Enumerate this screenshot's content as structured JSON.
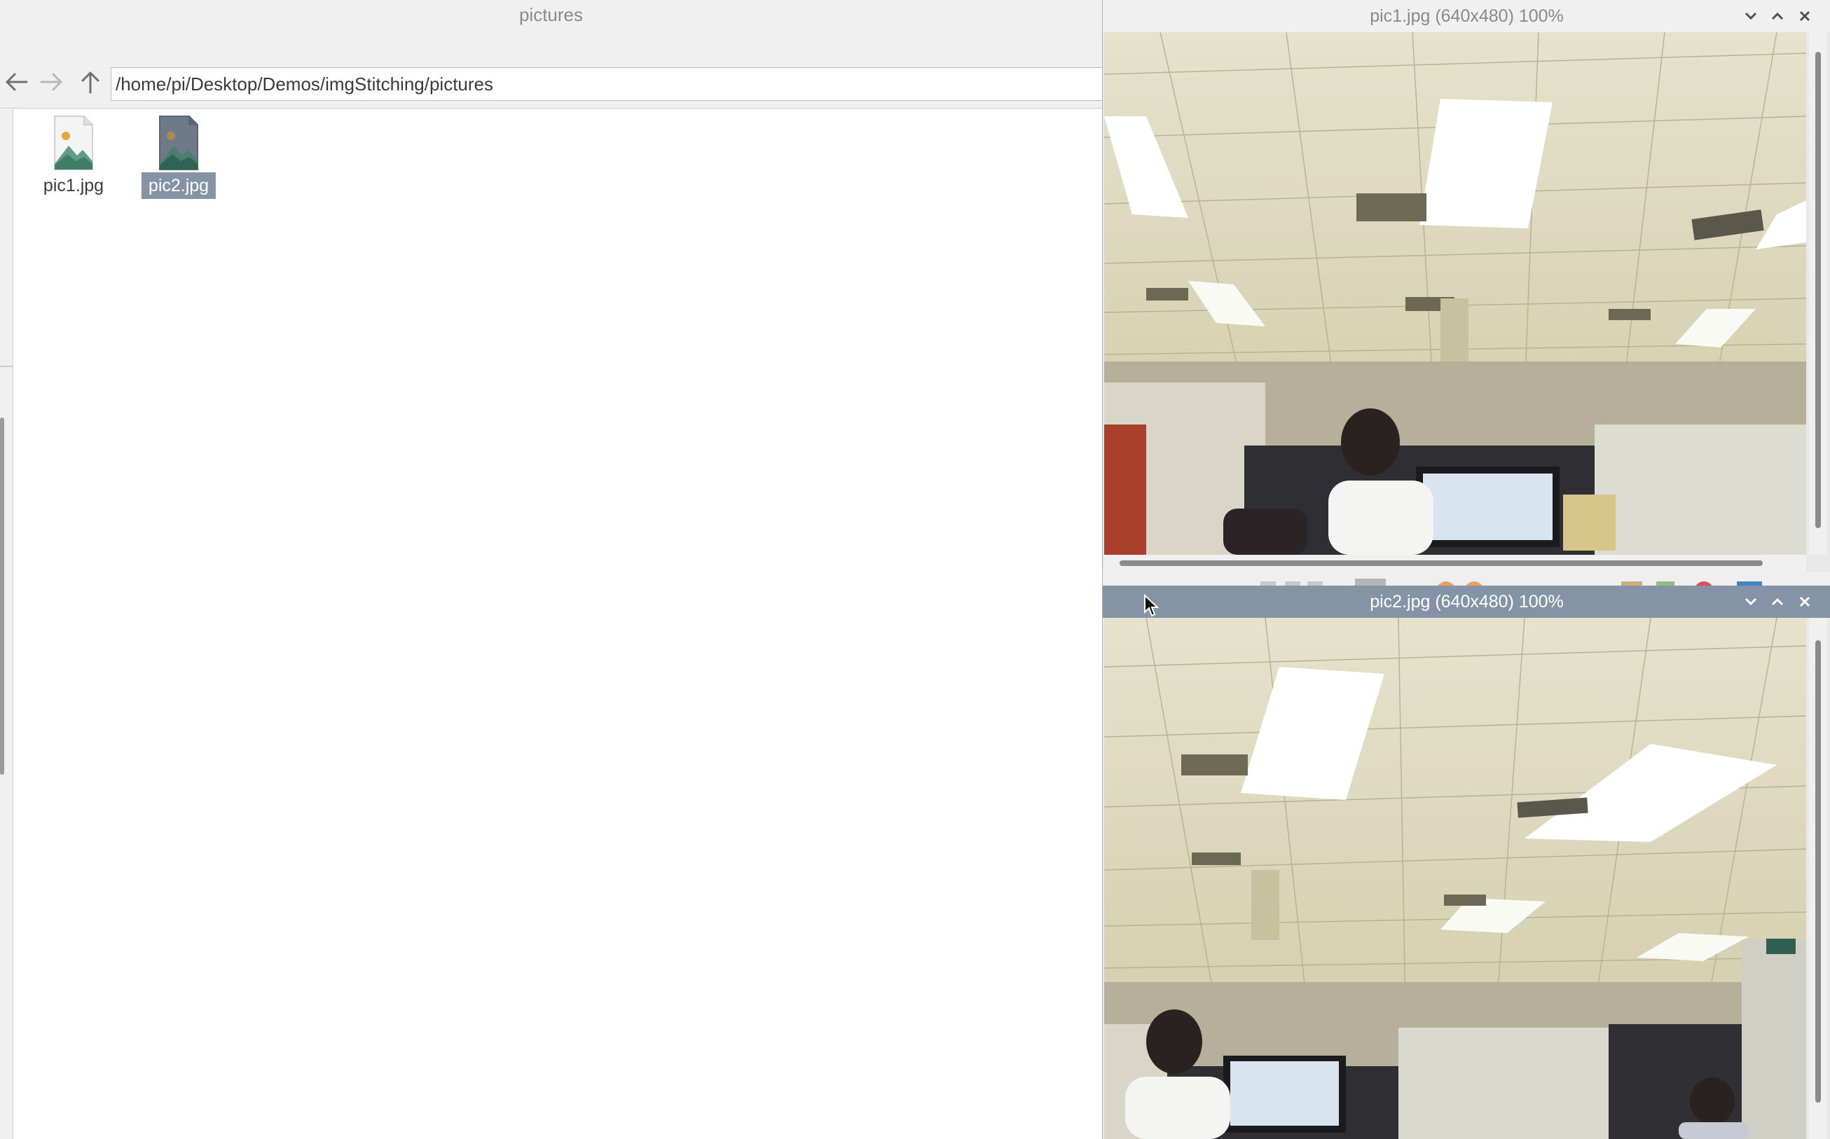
{
  "file_manager": {
    "title": "pictures",
    "path": "/home/pi/Desktop/Demos/imgStitching/pictures",
    "nav": {
      "back_icon": "arrow-left-icon",
      "forward_icon": "arrow-right-icon",
      "up_icon": "arrow-up-icon"
    },
    "files": [
      {
        "name": "pic1.jpg",
        "icon": "image-file-icon",
        "selected": false
      },
      {
        "name": "pic2.jpg",
        "icon": "image-file-icon",
        "selected": true
      }
    ],
    "selection_color": "#8593a7"
  },
  "viewers": [
    {
      "title": "pic1.jpg (640x480) 100%",
      "active": false,
      "buttons": {
        "minimize_icon": "chevron-down-icon",
        "maximize_icon": "chevron-up-icon",
        "close_icon": "close-icon"
      }
    },
    {
      "title": "pic2.jpg (640x480) 100%",
      "active": true,
      "buttons": {
        "minimize_icon": "chevron-down-icon",
        "maximize_icon": "chevron-up-icon",
        "close_icon": "close-icon"
      }
    }
  ],
  "colors": {
    "active_title": "#8593a7",
    "inactive_title": "#f0f0f0"
  }
}
